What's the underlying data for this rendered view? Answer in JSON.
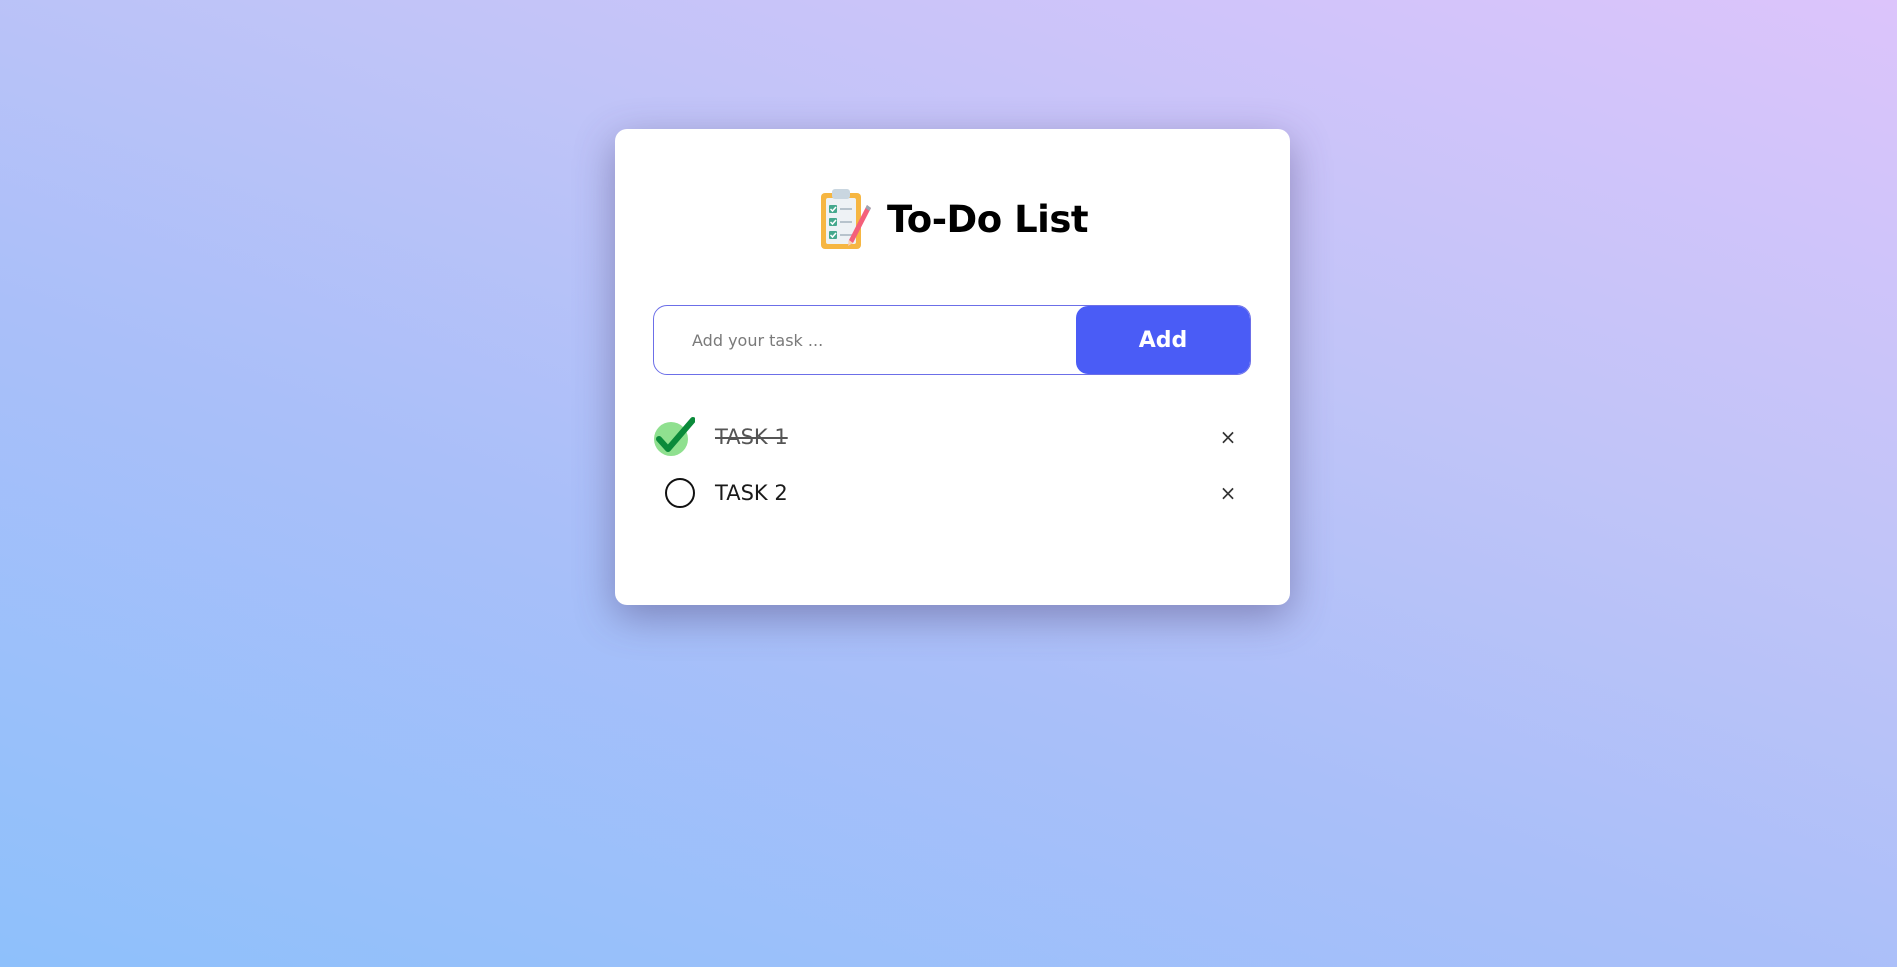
{
  "app": {
    "title": "To-Do List",
    "title_icon": "clipboard-checklist-icon"
  },
  "input": {
    "placeholder": "Add your task ...",
    "value": ""
  },
  "add_button": {
    "label": "Add"
  },
  "tasks": [
    {
      "label": "TASK 1",
      "completed": true,
      "delete_icon": "×"
    },
    {
      "label": "TASK 2",
      "completed": false,
      "delete_icon": "×"
    }
  ],
  "colors": {
    "accent": "#4a5cf6",
    "check_green": "#0b8a3a",
    "check_bg": "#8fe08f"
  }
}
